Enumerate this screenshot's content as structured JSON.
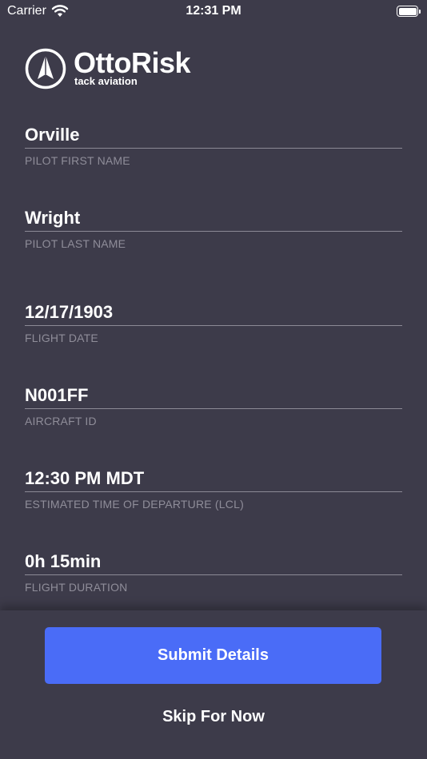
{
  "status_bar": {
    "carrier": "Carrier",
    "time": "12:31 PM",
    "wifi_icon": "wifi-icon",
    "battery_icon": "battery-icon"
  },
  "logo": {
    "name": "OttoRisk",
    "subtitle": "tack aviation",
    "icon": "paper-plane-logo-icon"
  },
  "fields": [
    {
      "value": "Orville",
      "label": "PILOT FIRST NAME"
    },
    {
      "value": "Wright",
      "label": "PILOT LAST NAME"
    },
    {
      "value": "12/17/1903",
      "label": "FLIGHT DATE"
    },
    {
      "value": "N001FF",
      "label": "AIRCRAFT ID"
    },
    {
      "value": "12:30 PM MDT",
      "label": "ESTIMATED TIME OF DEPARTURE (LCL)"
    },
    {
      "value": "0h 15min",
      "label": "FLIGHT DURATION"
    }
  ],
  "actions": {
    "submit_label": "Submit Details",
    "skip_label": "Skip For Now"
  },
  "colors": {
    "background": "#3d3b4a",
    "accent": "#4a6cf7",
    "label": "#8f8d99"
  }
}
